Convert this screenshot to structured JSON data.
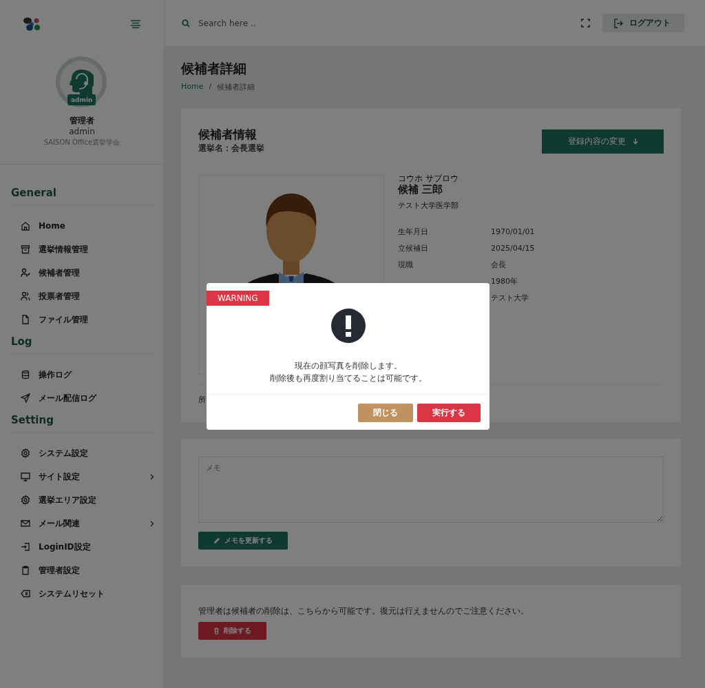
{
  "sidebar": {
    "profile": {
      "badge": "admin",
      "role": "管理者",
      "username": "admin",
      "organization": "SAISON Office選挙学会"
    },
    "sections": [
      {
        "title": "General",
        "items": [
          {
            "label": "Home",
            "has_submenu": false
          },
          {
            "label": "選挙情報管理",
            "has_submenu": false
          },
          {
            "label": "候補者管理",
            "has_submenu": false
          },
          {
            "label": "投票者管理",
            "has_submenu": false
          },
          {
            "label": "ファイル管理",
            "has_submenu": false
          }
        ]
      },
      {
        "title": "Log",
        "items": [
          {
            "label": "操作ログ",
            "has_submenu": false
          },
          {
            "label": "メール配信ログ",
            "has_submenu": false
          }
        ]
      },
      {
        "title": "Setting",
        "items": [
          {
            "label": "システム設定",
            "has_submenu": false
          },
          {
            "label": "サイト設定",
            "has_submenu": true
          },
          {
            "label": "選挙エリア設定",
            "has_submenu": false
          },
          {
            "label": "メール関連",
            "has_submenu": true
          },
          {
            "label": "LoginID設定",
            "has_submenu": false
          },
          {
            "label": "管理者設定",
            "has_submenu": false
          },
          {
            "label": "システムリセット",
            "has_submenu": false
          }
        ]
      }
    ]
  },
  "topbar": {
    "search": {
      "placeholder": "Search here .."
    },
    "logout_button": "ログアウト"
  },
  "page": {
    "title": "候補者詳細",
    "breadcrumb": [
      "Home",
      "候補者詳細"
    ],
    "breadcrumb_separator": "/"
  },
  "candidate_card": {
    "title": "候補者情報",
    "subtitle": "選挙名：会長選挙",
    "edit_button": "登録内容の変更",
    "furigana": "コウホ サブロウ",
    "name": "候補 三郎",
    "faculty": "テスト大学医学部",
    "details": [
      {
        "label": "生年月日",
        "value": "1970/01/01"
      },
      {
        "label": "立候補日",
        "value": "2025/04/15"
      },
      {
        "label": "現職",
        "value": "会長"
      },
      {
        "value": "1980年"
      },
      {
        "value": "テスト大学"
      }
    ],
    "footer_label": "所"
  },
  "memo_card": {
    "memo": {
      "placeholder": "メモ"
    },
    "update_button": "メモを更新する"
  },
  "delete_card": {
    "notice": "管理者は候補者の削除は、こちらから可能です。復元は行えませんのでご注意ください。",
    "delete_button": "削除する"
  },
  "modal": {
    "tag": "WARNING",
    "message": [
      "現在の顔写真を削除します。",
      "削除後も再度割り当てることは可能です。"
    ],
    "buttons": [
      {
        "label": "閉じる",
        "kind": "secondary"
      },
      {
        "label": "実行する",
        "kind": "primary"
      }
    ]
  }
}
